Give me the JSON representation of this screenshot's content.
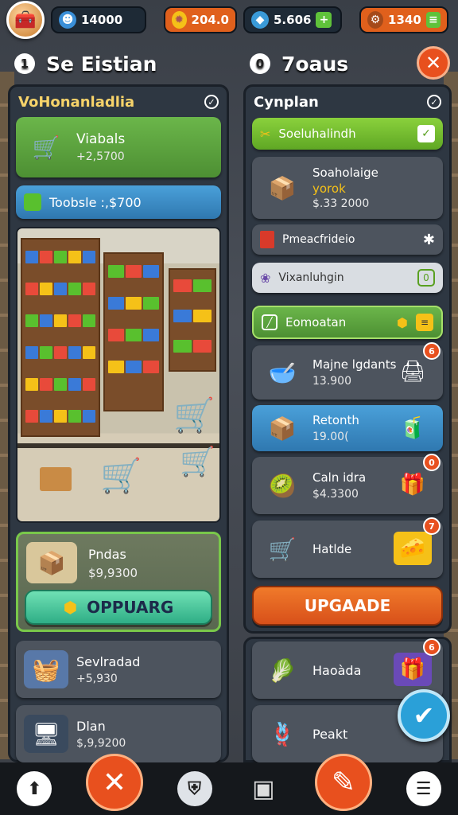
{
  "topbar": {
    "avatar_icon": "shop-icon",
    "resources": [
      {
        "icon": "person-icon",
        "value": "14000"
      },
      {
        "icon": "sun-coin-icon",
        "value": "204.0"
      },
      {
        "icon": "gem-icon",
        "value": "5.606"
      },
      {
        "icon": "gear-coin-icon",
        "value": "1340"
      }
    ]
  },
  "left_header": {
    "number": "1",
    "title": "Se Eistian"
  },
  "right_header": {
    "number": "0",
    "title": "7oaus"
  },
  "left_panel": {
    "title": "VoHonanladlia",
    "cards": [
      {
        "name": "Viabals",
        "value": "+2,5700"
      },
      {
        "name": "Toobsle :,$700"
      }
    ],
    "featured": {
      "name": "Pndas",
      "value": "$9,9300",
      "button": "OPPUARG"
    },
    "more": [
      {
        "name": "Sevlradad",
        "value": "+5,930"
      },
      {
        "name": "Dlan",
        "value": "$,9,9200"
      }
    ]
  },
  "right_panel": {
    "title": "Cynplan",
    "top_bar": "Soeluhalindh",
    "item1": {
      "name": "Soaholaige",
      "sub": "yorok",
      "value": "$.33 2000"
    },
    "row1": "Pmeacfrideio",
    "row2": "Vixanluhgin",
    "row3": "Eomoatan",
    "items": [
      {
        "name": "Majne lgdants",
        "value": "13.900",
        "badge": "6"
      },
      {
        "name": "Retonth",
        "value": "19.00("
      },
      {
        "name": "Caln idra",
        "value": "$4.3300",
        "badge": "0"
      },
      {
        "name": "Hatlde",
        "badge": "7"
      }
    ],
    "upgrade_button": "UPGAADE",
    "bottom_items": [
      {
        "name": "Haoàda",
        "badge": "6"
      },
      {
        "name": "Peakt"
      }
    ]
  },
  "bottom_nav": [
    "up-arrow-icon",
    "close-icon",
    "shield-icon",
    "box-icon",
    "edit-icon",
    "menu-icon"
  ],
  "colors": {
    "accent": "#e8501e",
    "green": "#6bb64a",
    "blue": "#2f78b0"
  }
}
